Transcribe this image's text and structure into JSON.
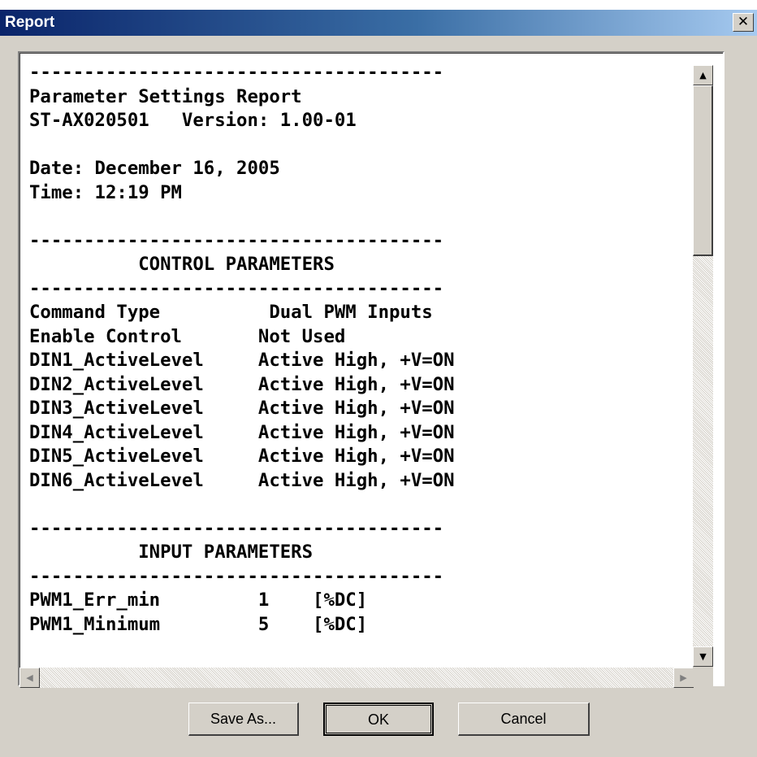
{
  "window": {
    "title": "Report",
    "close_glyph": "✕"
  },
  "report": {
    "lines": [
      "--------------------------------------",
      "Parameter Settings Report",
      "ST-AX020501   Version: 1.00-01",
      "",
      "Date: December 16, 2005",
      "Time: 12:19 PM",
      "",
      "--------------------------------------",
      "          CONTROL PARAMETERS",
      "--------------------------------------",
      "Command Type          Dual PWM Inputs",
      "Enable Control       Not Used",
      "DIN1_ActiveLevel     Active High, +V=ON",
      "DIN2_ActiveLevel     Active High, +V=ON",
      "DIN3_ActiveLevel     Active High, +V=ON",
      "DIN4_ActiveLevel     Active High, +V=ON",
      "DIN5_ActiveLevel     Active High, +V=ON",
      "DIN6_ActiveLevel     Active High, +V=ON",
      "",
      "--------------------------------------",
      "          INPUT PARAMETERS",
      "--------------------------------------",
      "PWM1_Err_min         1    [%DC]",
      "PWM1_Minimum         5    [%DC]"
    ]
  },
  "scrollbars": {
    "up_icon": "up-arrow-icon",
    "down_icon": "down-arrow-icon",
    "left_icon": "left-arrow-icon",
    "right_icon": "right-arrow-icon"
  },
  "buttons": {
    "save_as": "Save As...",
    "ok": "OK",
    "cancel": "Cancel"
  }
}
